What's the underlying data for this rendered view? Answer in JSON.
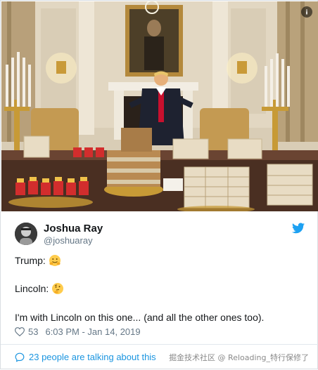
{
  "tweet": {
    "author_name": "Joshua Ray",
    "author_handle": "@joshuaray",
    "line1_text": "Trump:",
    "line1_emoji": "hugging-face-emoji",
    "line2_text": "Lincoln:",
    "line2_emoji": "thinking-face-emoji",
    "line3_text": "I'm with Lincoln on this one... (and all the other ones too).",
    "like_count": "53",
    "timestamp": "6:03 PM - Jan 14, 2019",
    "talking_text": "23 people are talking about this"
  },
  "watermark": "掘金技术社区 @ Reloading_特行保修了",
  "colors": {
    "twitter_blue": "#1da1f2",
    "link_blue": "#1b95e0",
    "muted_gray": "#657786",
    "divider": "#e1e8ed"
  },
  "icons": [
    "info-icon",
    "twitter-bird-icon",
    "heart-icon",
    "speech-bubble-icon"
  ]
}
